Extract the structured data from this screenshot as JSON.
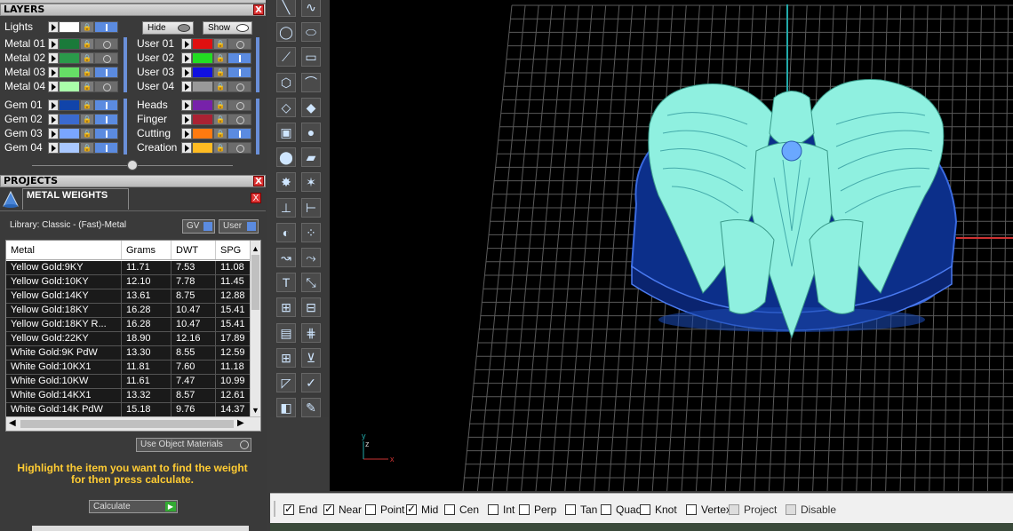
{
  "layers": {
    "title": "LAYERS",
    "close": "X",
    "lights_label": "Lights",
    "hide_label": "Hide",
    "show_label": "Show",
    "left_rows": [
      {
        "label": "Metal 01",
        "color": "#1a7a3a",
        "visible": false
      },
      {
        "label": "Metal 02",
        "color": "#2a9a4a",
        "visible": false
      },
      {
        "label": "Metal 03",
        "color": "#66dd66",
        "visible": true
      },
      {
        "label": "Metal 04",
        "color": "#aaffaa",
        "visible": false
      },
      {
        "label": "Gem 01",
        "color": "#1144aa",
        "visible": true
      },
      {
        "label": "Gem 02",
        "color": "#3a6ad0",
        "visible": true
      },
      {
        "label": "Gem 03",
        "color": "#7aa6ff",
        "visible": true
      },
      {
        "label": "Gem 04",
        "color": "#a9c8ff",
        "visible": true
      }
    ],
    "right_rows": [
      {
        "label": "User 01",
        "color": "#e01010",
        "visible": false
      },
      {
        "label": "User 02",
        "color": "#22dd22",
        "visible": true
      },
      {
        "label": "User 03",
        "color": "#1010e0",
        "visible": true
      },
      {
        "label": "User 04",
        "color": "#999999",
        "visible": false
      },
      {
        "label": "Heads",
        "color": "#7722aa",
        "visible": false
      },
      {
        "label": "Finger",
        "color": "#aa2233",
        "visible": false
      },
      {
        "label": "Cutting",
        "color": "#ff7a10",
        "visible": true
      },
      {
        "label": "Creation",
        "color": "#ffbb22",
        "visible": false
      }
    ]
  },
  "projects": {
    "title": "PROJECTS",
    "close": "X"
  },
  "metal_weights": {
    "title": "METAL WEIGHTS",
    "close": "X",
    "library": "Library: Classic - (Fast)-Metal",
    "gv_label": "GV",
    "user_label": "User",
    "columns": [
      "Metal",
      "Grams",
      "DWT",
      "SPG"
    ],
    "rows": [
      [
        "Yellow Gold:9KY",
        "11.71",
        "7.53",
        "11.08"
      ],
      [
        "Yellow Gold:10KY",
        "12.10",
        "7.78",
        "11.45"
      ],
      [
        "Yellow Gold:14KY",
        "13.61",
        "8.75",
        "12.88"
      ],
      [
        "Yellow Gold:18KY",
        "16.28",
        "10.47",
        "15.41"
      ],
      [
        "Yellow Gold:18KY R...",
        "16.28",
        "10.47",
        "15.41"
      ],
      [
        "Yellow Gold:22KY",
        "18.90",
        "12.16",
        "17.89"
      ],
      [
        "White Gold:9K PdW",
        "13.30",
        "8.55",
        "12.59"
      ],
      [
        "White Gold:10KX1",
        "11.81",
        "7.60",
        "11.18"
      ],
      [
        "White Gold:10KW",
        "11.61",
        "7.47",
        "10.99"
      ],
      [
        "White Gold:14KX1",
        "13.32",
        "8.57",
        "12.61"
      ],
      [
        "White Gold:14K PdW",
        "15.18",
        "9.76",
        "14.37"
      ]
    ],
    "use_object_materials": "Use Object Materials",
    "hint": "Highlight the item you want to find the weight for then press calculate.",
    "calculate": "Calculate"
  },
  "viewport": {
    "axis_x": "x",
    "axis_y": "y",
    "axis_z": "z"
  },
  "snaps": [
    {
      "label": "End",
      "checked": true
    },
    {
      "label": "Near",
      "checked": true
    },
    {
      "label": "Point",
      "checked": false
    },
    {
      "label": "Mid",
      "checked": true
    },
    {
      "label": "Cen",
      "checked": false
    },
    {
      "label": "Int",
      "checked": false
    },
    {
      "label": "Perp",
      "checked": false
    },
    {
      "label": "Tan",
      "checked": false
    },
    {
      "label": "Quad",
      "checked": false
    },
    {
      "label": "Knot",
      "checked": false
    },
    {
      "label": "Vertex",
      "checked": false
    },
    {
      "label": "Project",
      "checked": false,
      "disabled": true
    },
    {
      "label": "Disable",
      "checked": false,
      "disabled": true
    }
  ],
  "colors": {
    "accent": "#5b8be0",
    "model": "#8ff0e0",
    "ring": "#0a2a7a",
    "hint": "#ffcc33"
  }
}
